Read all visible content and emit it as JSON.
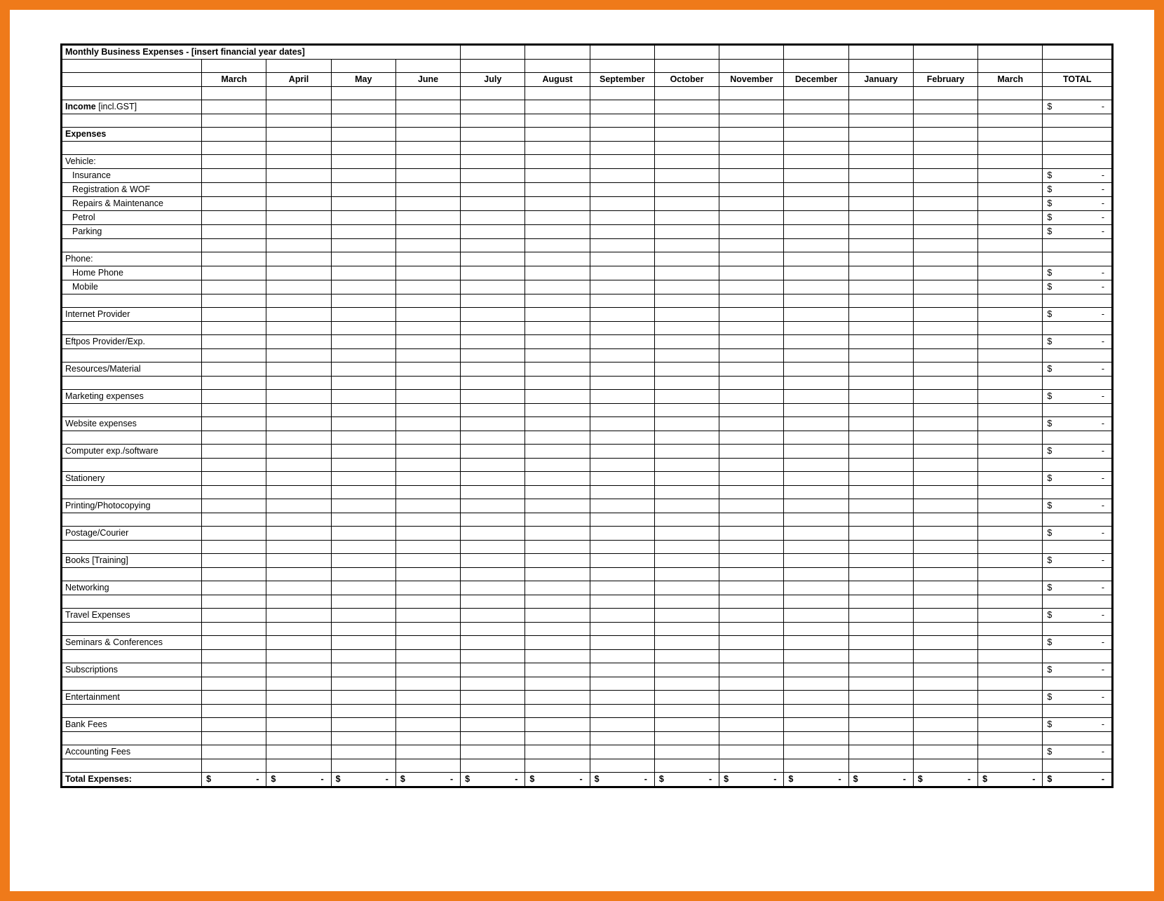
{
  "title": "Monthly Business Expenses - [insert financial year dates]",
  "months": [
    "March",
    "April",
    "May",
    "June",
    "July",
    "August",
    "September",
    "October",
    "November",
    "December",
    "January",
    "February",
    "March"
  ],
  "total_label": "TOTAL",
  "currency_symbol": "$",
  "dash": "-",
  "income_label": "Income",
  "income_suffix": " [incl.GST]",
  "expenses_header": "Expenses",
  "sections": [
    {
      "heading": "Vehicle:",
      "items": [
        "Insurance",
        "Registration & WOF",
        "Repairs & Maintenance",
        "Petrol",
        "Parking"
      ]
    },
    {
      "heading": "Phone:",
      "items": [
        "Home Phone",
        "Mobile"
      ]
    }
  ],
  "flat_items": [
    "Internet Provider",
    "Eftpos Provider/Exp.",
    "Resources/Material",
    "Marketing expenses",
    "Website expenses",
    "Computer exp./software",
    "Stationery",
    "Printing/Photocopying",
    "Postage/Courier",
    "Books [Training]",
    "Networking",
    "Travel Expenses",
    "Seminars & Conferences",
    "Subscriptions",
    "Entertainment",
    "Bank Fees",
    "Accounting Fees"
  ],
  "total_expenses_label": "Total Expenses:"
}
